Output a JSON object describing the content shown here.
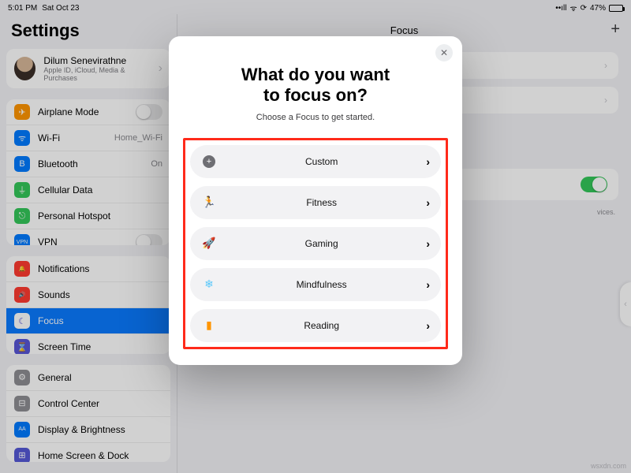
{
  "status_bar": {
    "time": "5:01 PM",
    "date": "Sat Oct 23",
    "battery_text": "47%"
  },
  "sidebar": {
    "title": "Settings",
    "account": {
      "name": "Dilum Senevirathne",
      "sub": "Apple ID, iCloud, Media & Purchases"
    },
    "group1": [
      {
        "icon_bg": "#ff9500",
        "icon": "✈",
        "label": "Airplane Mode",
        "trailing": "toggle_off"
      },
      {
        "icon_bg": "#007aff",
        "icon": "ᯤ",
        "label": "Wi-Fi",
        "value": "Home_Wi-Fi"
      },
      {
        "icon_bg": "#007aff",
        "icon": "B",
        "label": "Bluetooth",
        "value": "On"
      },
      {
        "icon_bg": "#34c759",
        "icon": "⏚",
        "label": "Cellular Data"
      },
      {
        "icon_bg": "#34c759",
        "icon": "⎋",
        "label": "Personal Hotspot"
      },
      {
        "icon_bg": "#007aff",
        "icon": "VPN",
        "label": "VPN",
        "trailing": "toggle_off"
      }
    ],
    "group2": [
      {
        "icon_bg": "#ff3b30",
        "icon": "🔔",
        "label": "Notifications"
      },
      {
        "icon_bg": "#ff3b30",
        "icon": "🔊",
        "label": "Sounds"
      },
      {
        "icon_bg": "#5856d6",
        "icon": "☾",
        "label": "Focus",
        "selected": true
      },
      {
        "icon_bg": "#5856d6",
        "icon": "⌛",
        "label": "Screen Time"
      }
    ],
    "group3": [
      {
        "icon_bg": "#8e8e93",
        "icon": "⚙",
        "label": "General"
      },
      {
        "icon_bg": "#8e8e93",
        "icon": "⊟",
        "label": "Control Center"
      },
      {
        "icon_bg": "#007aff",
        "icon": "AA",
        "label": "Display & Brightness"
      },
      {
        "icon_bg": "#5558d6",
        "icon": "⊞",
        "label": "Home Screen & Dock"
      }
    ]
  },
  "detail": {
    "header": "Focus",
    "hint_suffix": "vices."
  },
  "modal": {
    "title_l1": "What do you want",
    "title_l2": "to focus on?",
    "subtitle": "Choose a Focus to get started.",
    "options": [
      {
        "icon": "＋",
        "color": "#6e6e73",
        "bg": "#6e6e73",
        "label": "Custom"
      },
      {
        "icon": "🏃",
        "color": "#30d158",
        "label": "Fitness"
      },
      {
        "icon": "🚀",
        "color": "#0a84ff",
        "label": "Gaming"
      },
      {
        "icon": "❄",
        "color": "#5ac8fa",
        "label": "Mindfulness"
      },
      {
        "icon": "▮",
        "color": "#ff9500",
        "label": "Reading"
      }
    ]
  },
  "watermark": "wsxdn.com"
}
